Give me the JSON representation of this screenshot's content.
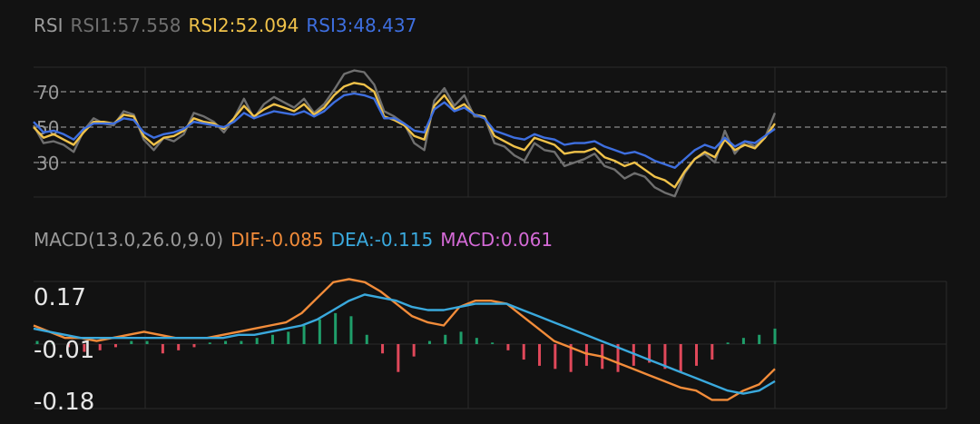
{
  "colors": {
    "background": "#121212",
    "grid": "#2b2b2b",
    "dash": "#8a8a8a",
    "label": "#9a9a9a",
    "rsi1": "#6f6f6f",
    "rsi2": "#f0c24a",
    "rsi3": "#3e6fe0",
    "dif": "#f28c3a",
    "dea": "#3aa9dd",
    "macd_pos": "#1f9e6a",
    "macd_neg": "#e0485a",
    "macd_label": "#d46ad6"
  },
  "rsi_legend": {
    "title": "RSI",
    "rsi1": "RSI1:57.558",
    "rsi2": "RSI2:52.094",
    "rsi3": "RSI3:48.437"
  },
  "macd_legend": {
    "title": "MACD(13.0,26.0,9.0)",
    "dif": "DIF:-0.085",
    "dea": "DEA:-0.115",
    "macd": "MACD:0.061"
  },
  "chart_data": [
    {
      "type": "line",
      "name": "RSI",
      "y_ticks": [
        "70",
        "50",
        "30"
      ],
      "y_tick_values": [
        70,
        50,
        30
      ],
      "ylim": [
        11,
        85
      ],
      "grid": true,
      "series": [
        {
          "name": "RSI1",
          "color": "#6f6f6f",
          "values": [
            51,
            41,
            42,
            40,
            36,
            48,
            55,
            52,
            51,
            59,
            57,
            43,
            37,
            44,
            42,
            46,
            58,
            56,
            53,
            47,
            55,
            66,
            55,
            63,
            67,
            64,
            61,
            66,
            58,
            63,
            71,
            80,
            82,
            81,
            74,
            59,
            56,
            52,
            41,
            37,
            65,
            72,
            62,
            68,
            56,
            56,
            41,
            39,
            34,
            31,
            41,
            37,
            36,
            28,
            30,
            32,
            35,
            28,
            26,
            21,
            24,
            22,
            16,
            13,
            11,
            24,
            32,
            35,
            30,
            48,
            35,
            42,
            39,
            44,
            58
          ]
        },
        {
          "name": "RSI2",
          "color": "#f0c24a",
          "values": [
            50,
            44,
            46,
            43,
            40,
            47,
            53,
            53,
            52,
            57,
            56,
            45,
            40,
            44,
            45,
            48,
            55,
            53,
            52,
            49,
            55,
            62,
            56,
            60,
            63,
            61,
            59,
            63,
            57,
            61,
            68,
            73,
            75,
            74,
            70,
            56,
            54,
            51,
            45,
            43,
            62,
            68,
            60,
            63,
            57,
            56,
            45,
            42,
            39,
            37,
            44,
            42,
            40,
            35,
            36,
            36,
            38,
            33,
            31,
            28,
            30,
            26,
            22,
            20,
            16,
            25,
            32,
            36,
            33,
            43,
            37,
            40,
            38,
            44,
            52
          ]
        },
        {
          "name": "RSI3",
          "color": "#3e6fe0",
          "values": [
            53,
            47,
            48,
            46,
            43,
            49,
            52,
            52,
            52,
            55,
            54,
            47,
            44,
            46,
            47,
            49,
            53,
            52,
            51,
            50,
            53,
            58,
            55,
            57,
            59,
            58,
            57,
            59,
            56,
            59,
            64,
            68,
            69,
            68,
            66,
            55,
            55,
            52,
            48,
            47,
            60,
            64,
            59,
            61,
            57,
            55,
            48,
            46,
            44,
            43,
            46,
            44,
            43,
            40,
            41,
            41,
            42,
            39,
            37,
            35,
            36,
            34,
            31,
            29,
            27,
            32,
            37,
            40,
            38,
            44,
            39,
            42,
            41,
            45,
            49
          ]
        }
      ]
    },
    {
      "type": "bar+line",
      "name": "MACD",
      "y_ticks": [
        "0.17",
        "-0.01",
        "-0.18"
      ],
      "y_tick_values": [
        0.17,
        -0.01,
        -0.18
      ],
      "ylim": [
        -0.205,
        0.205
      ],
      "series": [
        {
          "name": "DIF",
          "color": "#f28c3a",
          "values": [
            0.06,
            0.04,
            0.02,
            0.02,
            0.01,
            0.02,
            0.03,
            0.04,
            0.03,
            0.02,
            0.02,
            0.02,
            0.03,
            0.04,
            0.05,
            0.06,
            0.07,
            0.1,
            0.15,
            0.2,
            0.21,
            0.2,
            0.17,
            0.13,
            0.09,
            0.07,
            0.06,
            0.12,
            0.14,
            0.14,
            0.13,
            0.09,
            0.05,
            0.01,
            -0.01,
            -0.03,
            -0.04,
            -0.06,
            -0.08,
            -0.1,
            -0.12,
            -0.14,
            -0.15,
            -0.18,
            -0.18,
            -0.15,
            -0.13,
            -0.08
          ]
        },
        {
          "name": "DEA",
          "color": "#3aa9dd",
          "values": [
            0.05,
            0.04,
            0.03,
            0.02,
            0.02,
            0.02,
            0.02,
            0.02,
            0.02,
            0.02,
            0.02,
            0.02,
            0.02,
            0.03,
            0.03,
            0.04,
            0.05,
            0.06,
            0.08,
            0.11,
            0.14,
            0.16,
            0.15,
            0.14,
            0.12,
            0.11,
            0.11,
            0.12,
            0.13,
            0.13,
            0.13,
            0.11,
            0.09,
            0.07,
            0.05,
            0.03,
            0.01,
            -0.01,
            -0.03,
            -0.05,
            -0.07,
            -0.09,
            -0.11,
            -0.13,
            -0.15,
            -0.16,
            -0.15,
            -0.12
          ]
        },
        {
          "name": "MACD",
          "values": [
            0.01,
            0.005,
            -0.01,
            -0.025,
            -0.02,
            -0.01,
            0.01,
            0.01,
            -0.03,
            -0.02,
            -0.01,
            0.005,
            0.01,
            0.01,
            0.02,
            0.03,
            0.04,
            0.06,
            0.08,
            0.1,
            0.09,
            0.03,
            -0.03,
            -0.09,
            -0.04,
            0.01,
            0.03,
            0.04,
            0.02,
            0.005,
            -0.02,
            -0.05,
            -0.07,
            -0.08,
            -0.09,
            -0.07,
            -0.08,
            -0.09,
            -0.07,
            -0.06,
            -0.08,
            -0.09,
            -0.07,
            -0.05,
            0.005,
            0.02,
            0.03,
            0.05
          ]
        }
      ]
    }
  ]
}
